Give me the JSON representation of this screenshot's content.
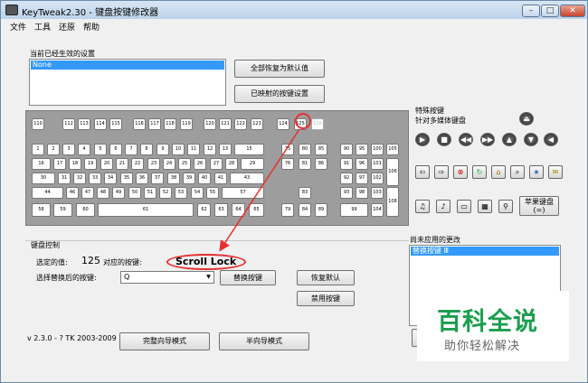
{
  "window": {
    "title": "KeyTweak2.30 -  键盘按键修改器",
    "controls": [
      "–",
      "□",
      "✕"
    ]
  },
  "menu": [
    "文件",
    "工具",
    "还原",
    "帮助"
  ],
  "current_settings": {
    "label": "当前已经生效的设置",
    "items": [
      "None"
    ]
  },
  "buttons": {
    "restore_all": "全部恢复为默认值",
    "mapped": "已映射的按键设置",
    "replace": "替换按键",
    "restore_default": "恢复默认",
    "disable": "禁用按键",
    "full_mode": "完整向导模式",
    "half_mode": "半向导模式"
  },
  "keyboard": {
    "row0": [
      "110",
      "112",
      "113",
      "114",
      "115",
      "116",
      "117",
      "118",
      "119",
      "120",
      "121",
      "122",
      "123",
      "124",
      "125",
      "126"
    ],
    "row1": [
      "1",
      "2",
      "3",
      "4",
      "5",
      "6",
      "7",
      "8",
      "9",
      "10",
      "11",
      "12",
      "13",
      "15"
    ],
    "row2": [
      "16",
      "17",
      "18",
      "19",
      "20",
      "21",
      "22",
      "23",
      "24",
      "25",
      "26",
      "27",
      "28",
      "29"
    ],
    "row3": [
      "30",
      "31",
      "32",
      "33",
      "34",
      "35",
      "36",
      "37",
      "38",
      "39",
      "40",
      "41",
      "43"
    ],
    "row4": [
      "44",
      "46",
      "47",
      "48",
      "49",
      "50",
      "51",
      "52",
      "53",
      "54",
      "55",
      "57"
    ],
    "row5": [
      "58",
      "59",
      "60",
      "61",
      "62",
      "63",
      "64",
      "65"
    ],
    "nav": [
      "75",
      "80",
      "85",
      "76",
      "81",
      "86",
      "83",
      "79",
      "84",
      "89"
    ],
    "numpad": [
      "90",
      "95",
      "100",
      "105",
      "91",
      "96",
      "101",
      "106",
      "92",
      "97",
      "102",
      "93",
      "98",
      "103",
      "108",
      "99",
      "104"
    ]
  },
  "special": {
    "title": "特殊按键",
    "subtitle": "针对多媒体键盘",
    "apple_button": "苹果键盘\n(=)"
  },
  "control": {
    "title": "键盘控制",
    "selected_value_label": "选定的值:",
    "selected_value": "125",
    "corresponding_label": "对应的按键:",
    "key_name": "Scroll Lock",
    "select_label": "选择替换后的按键:",
    "combo_value": "Q"
  },
  "pending": {
    "label": "尚未应用的更改",
    "items": [
      "替换按键 Ⅲ"
    ]
  },
  "footer": {
    "version": "v 2.3.0 - ? TK 2003-2009"
  },
  "watermark": {
    "title": "百科全说",
    "subtitle": "助你轻松解决"
  },
  "colors": {
    "highlight": "#e53030",
    "selection": "#3399ff",
    "keyboard_bg": "#9d9d9d"
  }
}
